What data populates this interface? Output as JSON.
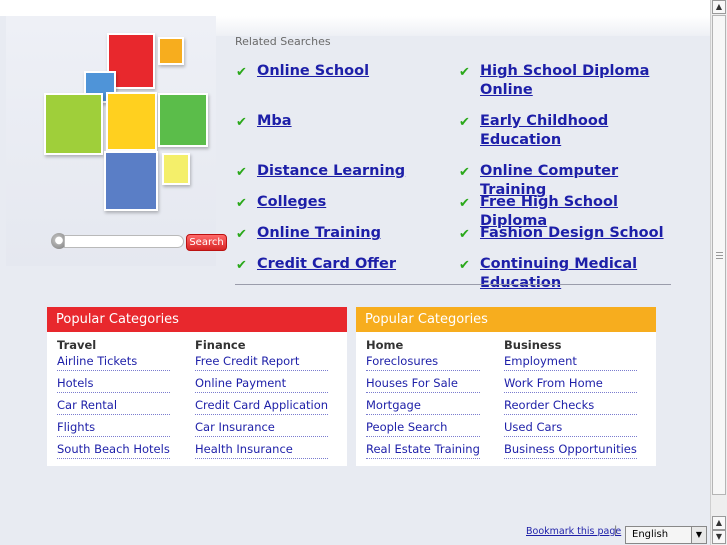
{
  "search": {
    "placeholder": "",
    "button_label": "Search",
    "icon": "magnifier-icon"
  },
  "related": {
    "title": "Related Searches",
    "check_icon": "✔",
    "left": [
      {
        "label": "Online School"
      },
      {
        "label": "Mba"
      },
      {
        "label": "Distance Learning"
      },
      {
        "label": "Colleges"
      },
      {
        "label": "Online Training"
      },
      {
        "label": "Credit Card Offer"
      }
    ],
    "right": [
      {
        "label": "High School Diploma Online"
      },
      {
        "label": "Early Childhood Education"
      },
      {
        "label": "Online Computer Training"
      },
      {
        "label": "Free High School Diploma"
      },
      {
        "label": "Fashion Design School"
      },
      {
        "label": "Continuing Medical Education"
      }
    ]
  },
  "categories": [
    {
      "header": "Popular Categories",
      "color": "#e8282d",
      "columns": [
        {
          "title": "Travel",
          "links": [
            "Airline Tickets",
            "Hotels",
            "Car Rental",
            "Flights",
            "South Beach Hotels"
          ]
        },
        {
          "title": "Finance",
          "links": [
            "Free Credit Report",
            "Online Payment",
            "Credit Card Application",
            "Car Insurance",
            "Health Insurance"
          ]
        }
      ]
    },
    {
      "header": "Popular Categories",
      "color": "#f7ad1e",
      "columns": [
        {
          "title": "Home",
          "links": [
            "Foreclosures",
            "Houses For Sale",
            "Mortgage",
            "People Search",
            "Real Estate Training"
          ]
        },
        {
          "title": "Business",
          "links": [
            "Employment",
            "Work From Home",
            "Reorder Checks",
            "Used Cars",
            "Business Opportunities"
          ]
        }
      ]
    }
  ],
  "footer": {
    "bookmark": "Bookmark this page",
    "separator": "|",
    "language": "English"
  },
  "colors": {
    "link": "#1d1fa8",
    "check": "#2aa81a",
    "search_button": "#d72525"
  }
}
